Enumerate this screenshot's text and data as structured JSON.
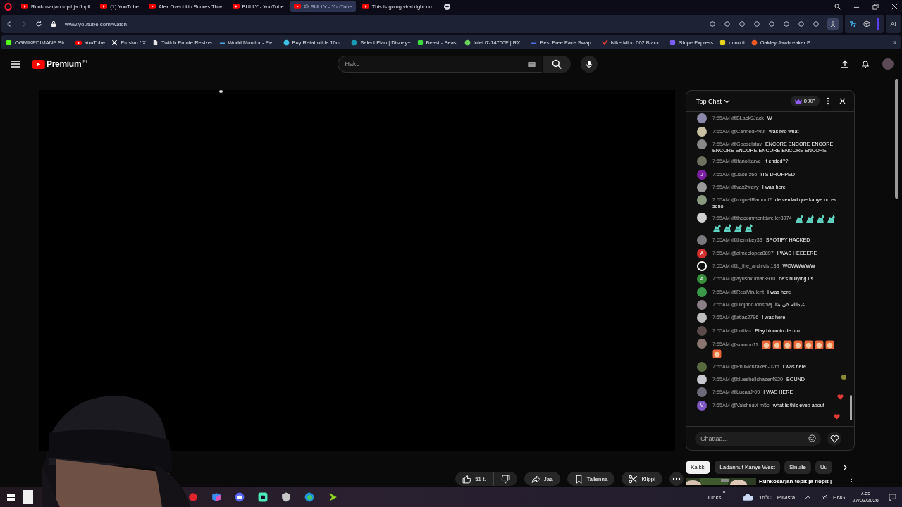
{
  "browser": {
    "tabs": [
      {
        "label": "Runkosarjan topit ja flopit",
        "selected": false,
        "audio": false
      },
      {
        "label": "(1) YouTube",
        "selected": false,
        "audio": false
      },
      {
        "label": "Alex Ovechkin Scores Thre",
        "selected": false,
        "audio": false
      },
      {
        "label": "BULLY - YouTube",
        "selected": false,
        "audio": false
      },
      {
        "label": "BULLY - YouTube",
        "selected": true,
        "audio": true
      },
      {
        "label": "This is going viral right no",
        "selected": false,
        "audio": false
      }
    ],
    "url": "www.youtube.com/watch",
    "toolbar_ai": "AI",
    "bookmarks": [
      {
        "label": "OGMIKEDIMANE Str...",
        "kind": "square",
        "color": "#53fc18"
      },
      {
        "label": "YouTube",
        "kind": "play",
        "color": "#ff0000"
      },
      {
        "label": "Etusivu / X",
        "kind": "x",
        "color": "#ffffff"
      },
      {
        "label": "Twitch Emote Resizer",
        "kind": "page",
        "color": "#e6e6e6"
      },
      {
        "label": "World Monitor - Re...",
        "kind": "dash",
        "color": "#4aa3df"
      },
      {
        "label": "Buy Retatrutide 10m...",
        "kind": "round",
        "color": "#3fc1e6"
      },
      {
        "label": "Select Plan | Disney+",
        "kind": "round",
        "color": "#1a9bb5"
      },
      {
        "label": "Beast - Beast",
        "kind": "square",
        "color": "#3ddc3d"
      },
      {
        "label": "Intel i7-14700F | RX...",
        "kind": "round",
        "color": "#6bd35a"
      },
      {
        "label": "Best Free Face Swap...",
        "kind": "dash",
        "color": "#4a6ee0"
      },
      {
        "label": "Nike Mind 002 Black...",
        "kind": "check",
        "color": "#e53935"
      },
      {
        "label": "Stripe Express",
        "kind": "square",
        "color": "#7b5cff"
      },
      {
        "label": "uuno.fi",
        "kind": "square",
        "color": "#e8d21d"
      },
      {
        "label": "Oakley Jawbreaker P...",
        "kind": "round",
        "color": "#ef5a24"
      }
    ],
    "more": "»"
  },
  "youtube": {
    "logo": "Premium",
    "region": "FI",
    "search": {
      "placeholder": "Haku"
    },
    "actions": {
      "likes": "51 t.",
      "share": "Jaa",
      "save": "Tallenna",
      "clip": "Klippi"
    },
    "chips": [
      {
        "label": "Kaikki",
        "selected": true
      },
      {
        "label": "Ladannut Kanye West",
        "selected": false
      },
      {
        "label": "Sinulle",
        "selected": false
      },
      {
        "label": "Uu",
        "selected": false
      }
    ],
    "related": {
      "title": "Runkosarjan topit ja flopit |"
    }
  },
  "chat": {
    "title": "Top Chat",
    "xp": "0 XP",
    "placeholder": "Chattaa...",
    "messages": [
      {
        "time": "7:55AM",
        "author": "@BLack9Jack",
        "text": "W"
      },
      {
        "time": "7:55AM",
        "author": "@CannedPNut",
        "text": "wait bro what"
      },
      {
        "time": "7:55AM",
        "author": "@Gooselstav",
        "text": "ENCORE ENCORE ENCORE ENCORE ENCORE ENCORE ENCORE ENCORE"
      },
      {
        "time": "7:55AM",
        "author": "@itanolitarve",
        "text": "it ended??"
      },
      {
        "avatar": {
          "kind": "letter",
          "letter": "J",
          "color": "#7b1fa2"
        },
        "time": "7:55AM",
        "author": "@Jace-z6o",
        "text": "ITS DROPPED"
      },
      {
        "time": "7:55AM",
        "author": "@vax2wavy",
        "text": "I was here"
      },
      {
        "time": "7:55AM",
        "author": "@miguelRamoni7",
        "text": "de verdad que kanye no es seno"
      },
      {
        "time": "7:55AM",
        "author": "@thecommentdweller8074",
        "emotes": [
          {
            "kind": "goat"
          },
          {
            "kind": "goat"
          },
          {
            "kind": "goat"
          },
          {
            "kind": "goat"
          },
          {
            "kind": "goat"
          },
          {
            "kind": "goat"
          },
          {
            "kind": "goat"
          },
          {
            "kind": "goat"
          }
        ]
      },
      {
        "time": "7:55AM",
        "author": "@themikey33",
        "text": "SPOTIFY HACKED"
      },
      {
        "avatar": {
          "kind": "letter",
          "letter": "A",
          "color": "#d32f2f"
        },
        "time": "7:55AM",
        "author": "@aimeelopez8897",
        "text": "I WAS HEEEERE"
      },
      {
        "avatar": {
          "kind": "ring",
          "color": "#ffffff"
        },
        "time": "7:55AM",
        "author": "@b_the_archivist138",
        "text": "WOWWWWW"
      },
      {
        "avatar": {
          "kind": "letter",
          "letter": "A",
          "color": "#388e3c"
        },
        "time": "7:55AM",
        "author": "@ayushkumar3910",
        "text": "he's bullying us"
      },
      {
        "time": "7:55AM",
        "author": "@RealVirulent",
        "text": "I was here"
      },
      {
        "time": "7:55AM",
        "author": "@DidjdodJdhsowj",
        "text": "عبدالله كان هنا"
      },
      {
        "time": "7:55AM",
        "author": "@atlas2796",
        "text": "I was here"
      },
      {
        "time": "7:55AM",
        "author": "@butifax",
        "text": "Play binomio de oro"
      },
      {
        "time": "7:55AM",
        "author": "@sonnnn11",
        "emotes": [
          {
            "kind": "cat"
          },
          {
            "kind": "cat"
          },
          {
            "kind": "cat"
          },
          {
            "kind": "cat"
          },
          {
            "kind": "cat"
          },
          {
            "kind": "cat"
          },
          {
            "kind": "cat"
          },
          {
            "kind": "cat"
          }
        ]
      },
      {
        "time": "7:55AM",
        "author": "@PhilMcKraken-u2m",
        "text": "I was here"
      },
      {
        "time": "7:55AM",
        "author": "@blueshellchaser4920",
        "text": "BOUND"
      },
      {
        "time": "7:55AM",
        "author": "@LucasJr09",
        "text": "I WAS HERE"
      },
      {
        "avatar": {
          "kind": "letter",
          "letter": "V",
          "color": "#7e57c2"
        },
        "time": "7:55AM",
        "author": "@Vaishnavi-m5c",
        "text": "what is this eveb about"
      }
    ]
  },
  "taskbar": {
    "links": "Links",
    "more": "»",
    "temperature": "16°C",
    "weather": "Pilvistä",
    "language": "ENG",
    "time": "7.55",
    "date": "27/03/2026"
  }
}
